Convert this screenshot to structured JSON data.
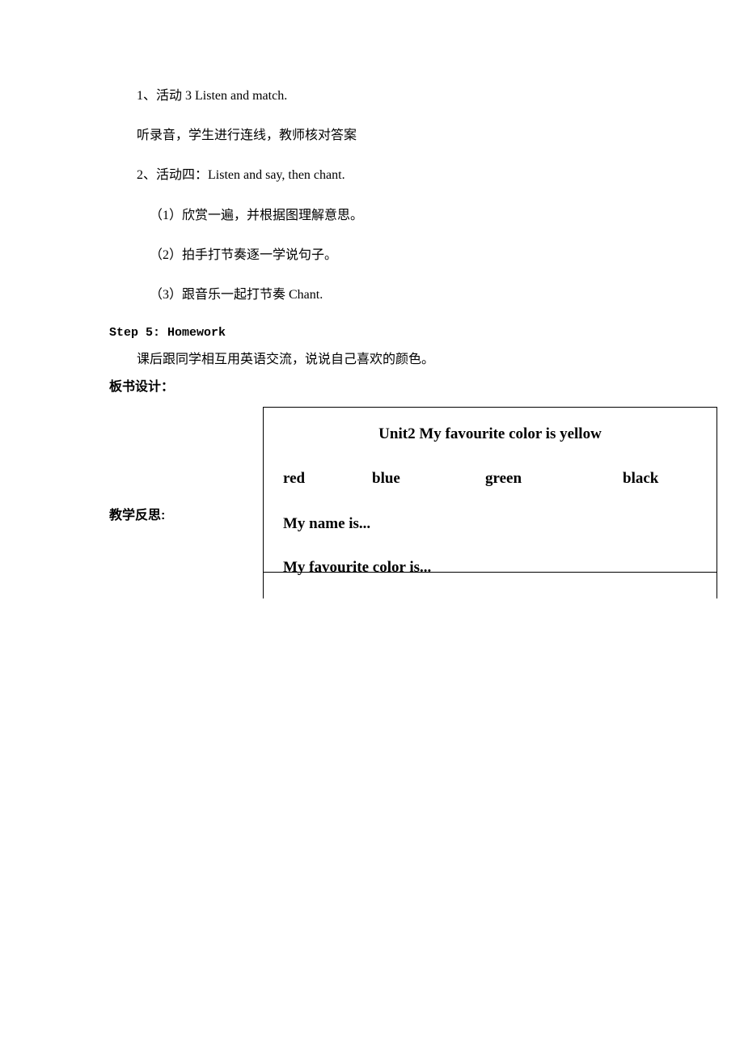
{
  "lines": {
    "l1": "1、活动 3 Listen and match.",
    "l2": "听录音，学生进行连线，教师核对答案",
    "l3": "2、活动四：Listen and say, then chant.",
    "l4": "（1）欣赏一遍，并根据图理解意思。",
    "l5": "（2）拍手打节奏逐一学说句子。",
    "l6": "（3）跟音乐一起打节奏 Chant.",
    "step5": "Step 5: Homework",
    "homework": "课后跟同学相互用英语交流，说说自己喜欢的颜色。",
    "boardLabel": "板书设计：",
    "reflectLabel": "教学反思:"
  },
  "board": {
    "title": "Unit2 My favourite color is yellow",
    "colors": {
      "c1": "red",
      "c2": "blue",
      "c3": "green",
      "c4": "black"
    },
    "sentence1": "My name is...",
    "sentence2": "My favourite color is..."
  }
}
